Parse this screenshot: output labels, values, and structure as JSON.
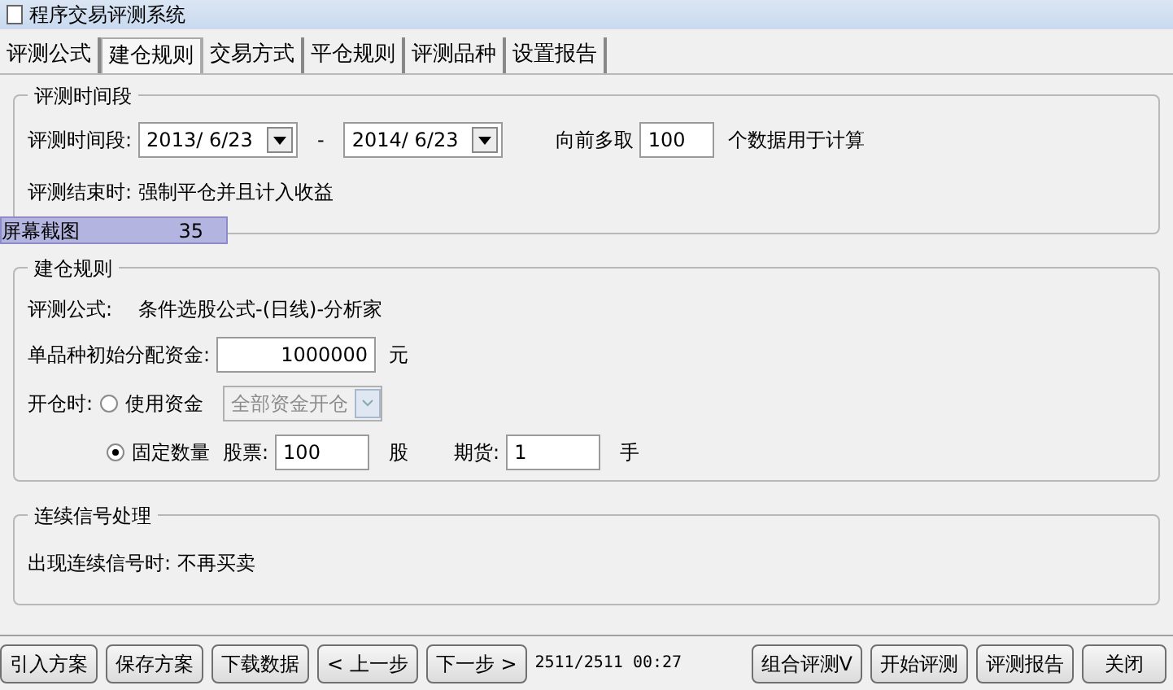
{
  "window": {
    "title": "程序交易评测系统"
  },
  "tabs": [
    {
      "label": "评测公式",
      "selected": false
    },
    {
      "label": "建仓规则",
      "selected": true
    },
    {
      "label": "交易方式",
      "selected": false
    },
    {
      "label": "平仓规则",
      "selected": false
    },
    {
      "label": "评测品种",
      "selected": false
    },
    {
      "label": "设置报告",
      "selected": false
    }
  ],
  "period_group": {
    "title": "评测时间段",
    "label": "评测时间段:",
    "start_date": "2013/ 6/23",
    "separator": "-",
    "end_date": "2014/ 6/23",
    "lookback_label": "向前多取",
    "lookback_value": "100",
    "lookback_suffix": "个数据用于计算",
    "end_label": "评测结束时:",
    "end_value": "强制平仓并且计入收益"
  },
  "capture_overlay": {
    "label": "屏幕截图",
    "count": "35"
  },
  "entry_group": {
    "title": "建仓规则",
    "formula_label": "评测公式:",
    "formula_value": "条件选股公式-(日线)-分析家",
    "capital_label": "单品种初始分配资金:",
    "capital_value": "1000000",
    "capital_unit": "元",
    "open_label": "开仓时:",
    "options": [
      {
        "label": "使用资金",
        "selected": false,
        "dropdown": {
          "value": "全部资金开仓",
          "disabled": true
        }
      },
      {
        "label": "固定数量",
        "selected": true,
        "stock_label": "股票:",
        "stock_value": "100",
        "stock_unit": "股",
        "futures_label": "期货:",
        "futures_value": "1",
        "futures_unit": "手"
      }
    ]
  },
  "signal_group": {
    "title": "连续信号处理",
    "label": "出现连续信号时:",
    "value": "不再买卖"
  },
  "footer": {
    "left_buttons": [
      "引入方案",
      "保存方案",
      "下载数据",
      "< 上一步",
      "下一步 >"
    ],
    "status": "2511/2511 00:27",
    "right_buttons": [
      "组合评测V",
      "开始评测",
      "评测报告",
      "关闭"
    ]
  }
}
